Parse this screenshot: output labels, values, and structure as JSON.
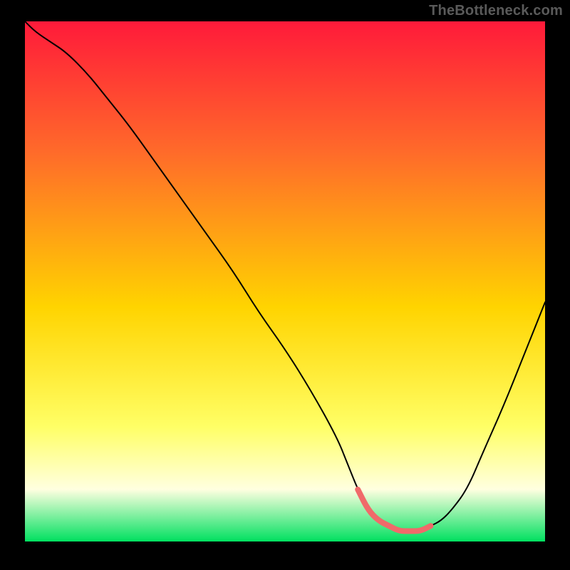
{
  "watermark": "TheBottleneck.com",
  "colors": {
    "background": "#000000",
    "gradient_top": "#ff1a3a",
    "gradient_mid_upper": "#ff6a2a",
    "gradient_mid": "#ffd400",
    "gradient_low": "#ffff66",
    "gradient_pale": "#ffffe0",
    "gradient_bottom": "#00e060",
    "curve": "#000000",
    "highlight_segment": "#f06a6a"
  },
  "chart_data": {
    "type": "line",
    "title": "",
    "xlabel": "",
    "ylabel": "",
    "xlim": [
      0,
      100
    ],
    "ylim": [
      0,
      100
    ],
    "x": [
      0,
      2,
      5,
      8,
      12,
      16,
      20,
      25,
      30,
      35,
      40,
      45,
      50,
      55,
      60,
      62,
      64,
      66,
      68,
      70,
      72,
      74,
      76,
      78,
      80,
      82,
      85,
      88,
      92,
      96,
      100
    ],
    "values": [
      100,
      98,
      96,
      94,
      90,
      85,
      80,
      73,
      66,
      59,
      52,
      44,
      37,
      29,
      20,
      15,
      10,
      6,
      4,
      3,
      2,
      2,
      2,
      3,
      4,
      6,
      10,
      17,
      26,
      36,
      46
    ],
    "highlight_range": {
      "x_start": 64,
      "x_end": 78
    },
    "gradient_stops": [
      {
        "offset": 0,
        "color": "#ff1a3a"
      },
      {
        "offset": 25,
        "color": "#ff6a2a"
      },
      {
        "offset": 55,
        "color": "#ffd400"
      },
      {
        "offset": 78,
        "color": "#ffff66"
      },
      {
        "offset": 90,
        "color": "#ffffe0"
      },
      {
        "offset": 100,
        "color": "#00e060"
      }
    ]
  }
}
